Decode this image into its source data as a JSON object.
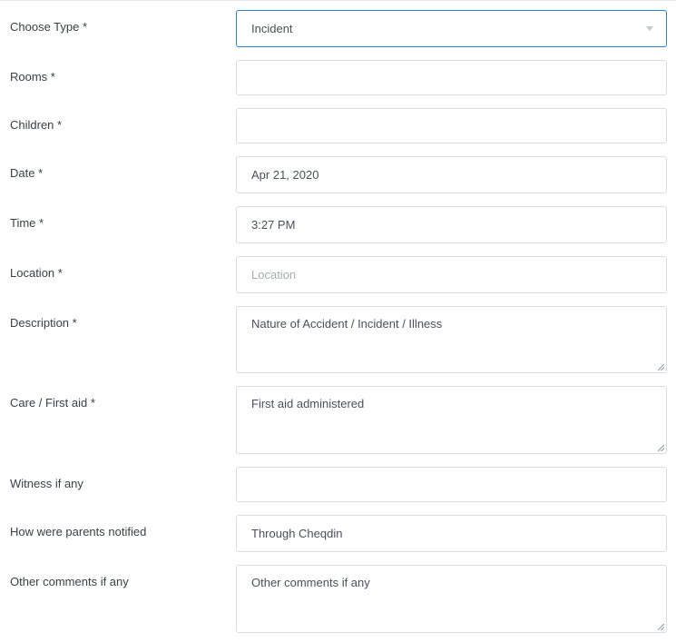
{
  "form": {
    "choose_type": {
      "label": "Choose Type *",
      "value": "Incident"
    },
    "rooms": {
      "label": "Rooms *",
      "value": ""
    },
    "children": {
      "label": "Children *",
      "value": ""
    },
    "date": {
      "label": "Date *",
      "value": "Apr 21, 2020"
    },
    "time": {
      "label": "Time *",
      "value": "3:27 PM"
    },
    "location": {
      "label": "Location *",
      "placeholder": "Location"
    },
    "description": {
      "label": "Description *",
      "value": "Nature of Accident / Incident / Illness"
    },
    "care_first_aid": {
      "label": "Care / First aid *",
      "value": "First aid administered"
    },
    "witness": {
      "label": "Witness if any",
      "value": ""
    },
    "parents_notified": {
      "label": "How were parents notified",
      "value": "Through Cheqdin"
    },
    "other_comments": {
      "label": "Other comments if any",
      "value": "Other comments if any"
    }
  }
}
